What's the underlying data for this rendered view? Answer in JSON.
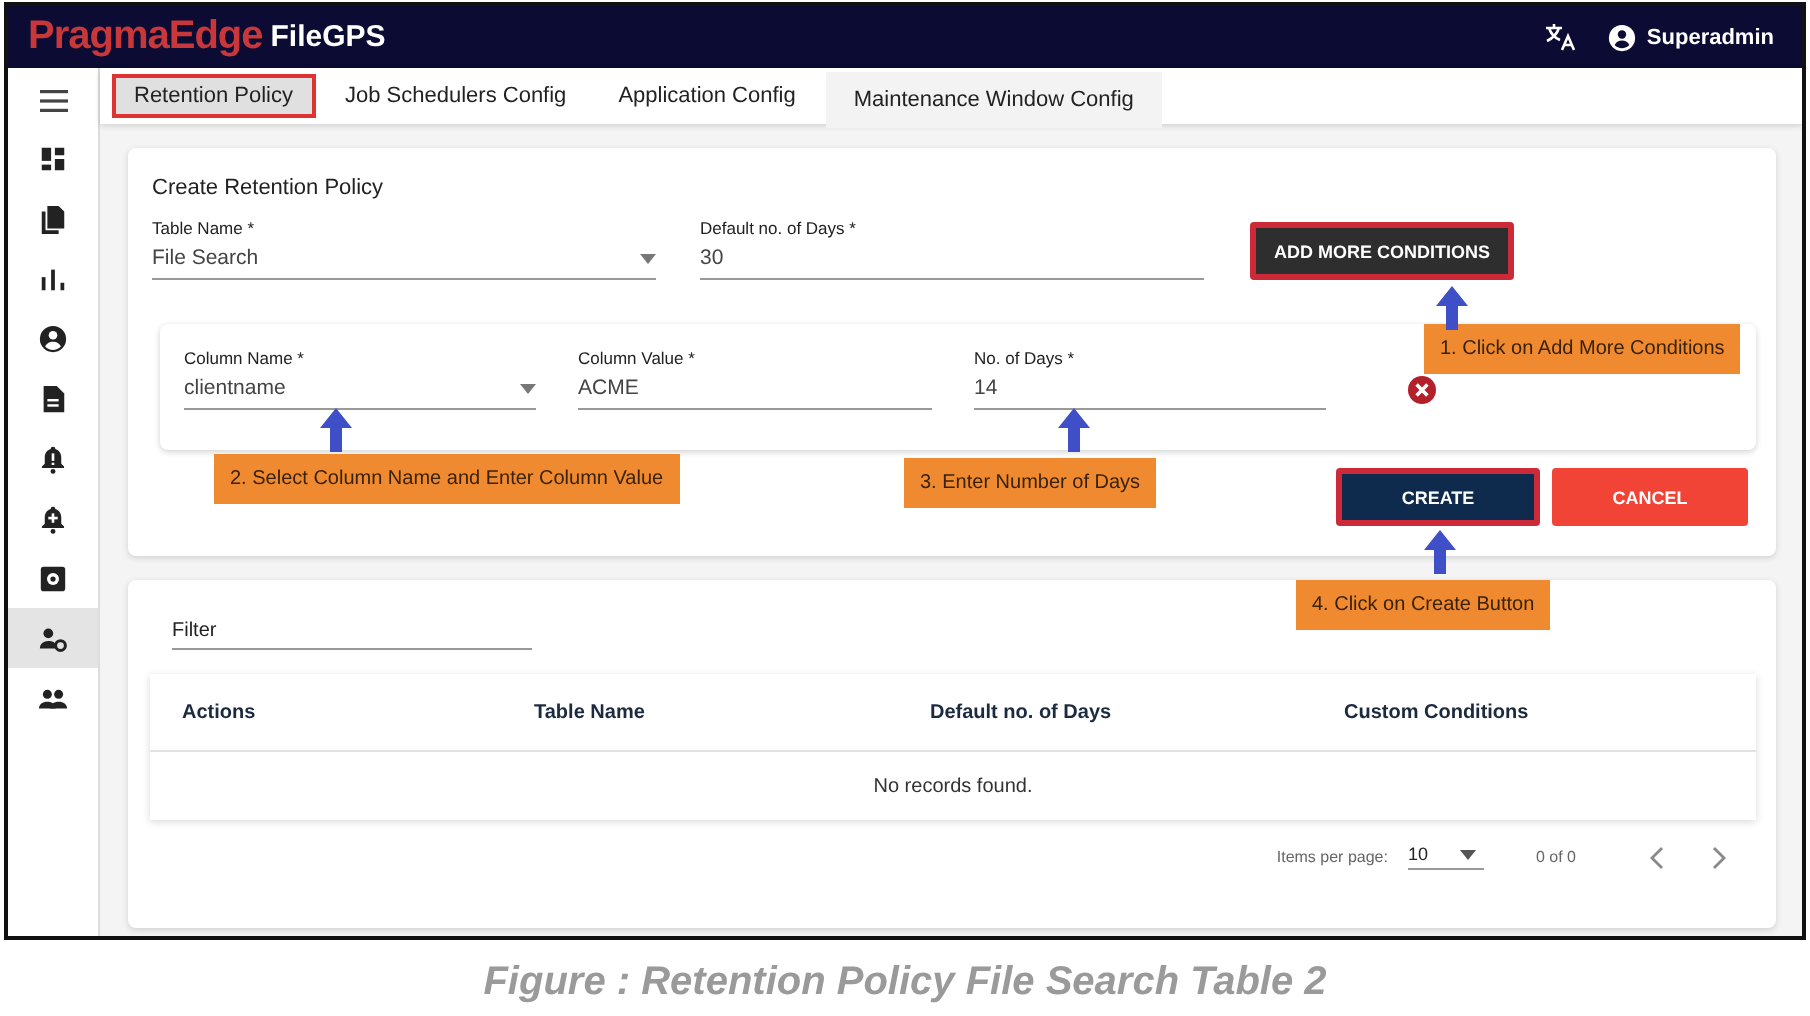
{
  "header": {
    "brand": "PragmaEdge",
    "product": "FileGPS",
    "user": "Superadmin"
  },
  "sidebar": {
    "items": [
      {
        "selected": false
      },
      {
        "selected": false
      },
      {
        "selected": false
      },
      {
        "selected": false
      },
      {
        "selected": false
      },
      {
        "selected": false
      },
      {
        "selected": false
      },
      {
        "selected": false
      },
      {
        "selected": true
      },
      {
        "selected": false
      }
    ]
  },
  "tabs": [
    {
      "label": "Retention Policy",
      "selected": true,
      "highlighted": true
    },
    {
      "label": "Job Schedulers Config",
      "selected": false,
      "highlighted": false
    },
    {
      "label": "Application Config",
      "selected": false,
      "highlighted": false
    },
    {
      "label": "Maintenance Window Config",
      "selected": false,
      "highlighted": false
    }
  ],
  "create_form": {
    "title": "Create Retention Policy",
    "table_name": {
      "label": "Table Name *",
      "value": "File Search"
    },
    "default_days": {
      "label": "Default no. of Days *",
      "value": "30"
    },
    "add_button": {
      "label": "ADD MORE CONDITIONS",
      "highlighted": true
    },
    "condition": {
      "column_name": {
        "label": "Column Name *",
        "value": "clientname"
      },
      "column_value": {
        "label": "Column Value *",
        "value": "ACME"
      },
      "days": {
        "label": "No. of Days *",
        "value": "14"
      }
    },
    "create_button": {
      "label": "CREATE",
      "highlighted": true
    },
    "cancel_button": {
      "label": "CANCEL",
      "highlighted": false
    }
  },
  "records": {
    "filter": {
      "placeholder": "Filter"
    },
    "table": {
      "columns": [
        "Actions",
        "Table Name",
        "Default no. of Days",
        "Custom Conditions"
      ],
      "empty_message": "No records found."
    },
    "paginator": {
      "items_per_page_label": "Items per page:",
      "page_size": "10",
      "range": "0 of 0"
    }
  },
  "callouts": [
    {
      "text": "1. Click on Add More Conditions"
    },
    {
      "text": "2. Select Column Name and Enter Column Value"
    },
    {
      "text": "3. Enter Number of Days"
    },
    {
      "text": "4. Click on Create Button"
    }
  ],
  "caption": "Figure : Retention Policy File Search Table 2"
}
